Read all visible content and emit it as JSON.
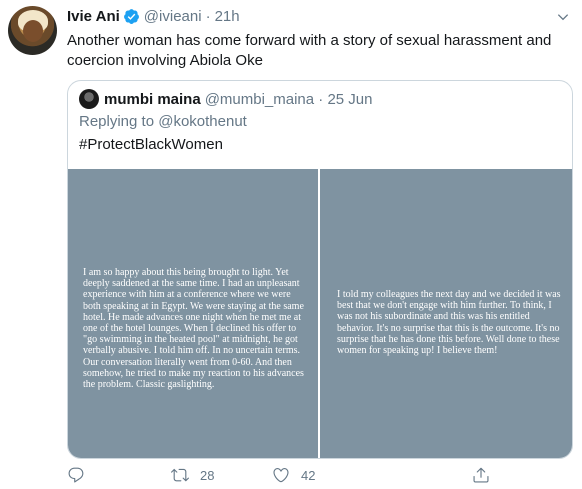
{
  "tweet": {
    "author_name": "Ivie Ani",
    "author_handle": "@ivieani",
    "separator": "·",
    "time": "21h",
    "text": "Another woman has come forward with a story of sexual harassment and coercion involving Abiola Oke",
    "verified": true
  },
  "quote": {
    "author_name": "mumbi maina",
    "author_handle": "@mumbi_maina · 25 Jun",
    "replying_to": "Replying to @kokothenut",
    "hashtag": "#ProtectBlackWomen",
    "image_left_text": "I am so happy about this being brought to light. Yet deeply saddened at the same time. I had an unpleasant experience with him at a conference where we were both speaking at in Egypt. We were staying at the same hotel. He made advances one night when he met me at one of the hotel lounges. When I declined his offer to \"go swimming in the heated pool\" at midnight, he got verbally abusive. I told him off. In no uncertain terms. Our conversation literally went from 0-60. And then somehow, he tried to make my reaction to his advances the problem. Classic gaslighting.",
    "image_right_text": "I told my colleagues the next day and we decided it was best that we don't engage with him further. To think, I was not his subordinate and this was his entitled behavior. It's no surprise that this is the outcome. It's no surprise that he has done this before. Well done to these women for speaking up! I believe them!"
  },
  "actions": {
    "reply_count": "",
    "retweet_count": "28",
    "like_count": "42"
  },
  "colors": {
    "verified": "#1da1f2",
    "secondary_text": "#657786",
    "border": "#ccd6dd",
    "image_bg": "#7f93a1"
  },
  "icons": [
    "verified-icon",
    "chevron-down-icon",
    "reply-icon",
    "retweet-icon",
    "like-icon",
    "share-icon"
  ]
}
